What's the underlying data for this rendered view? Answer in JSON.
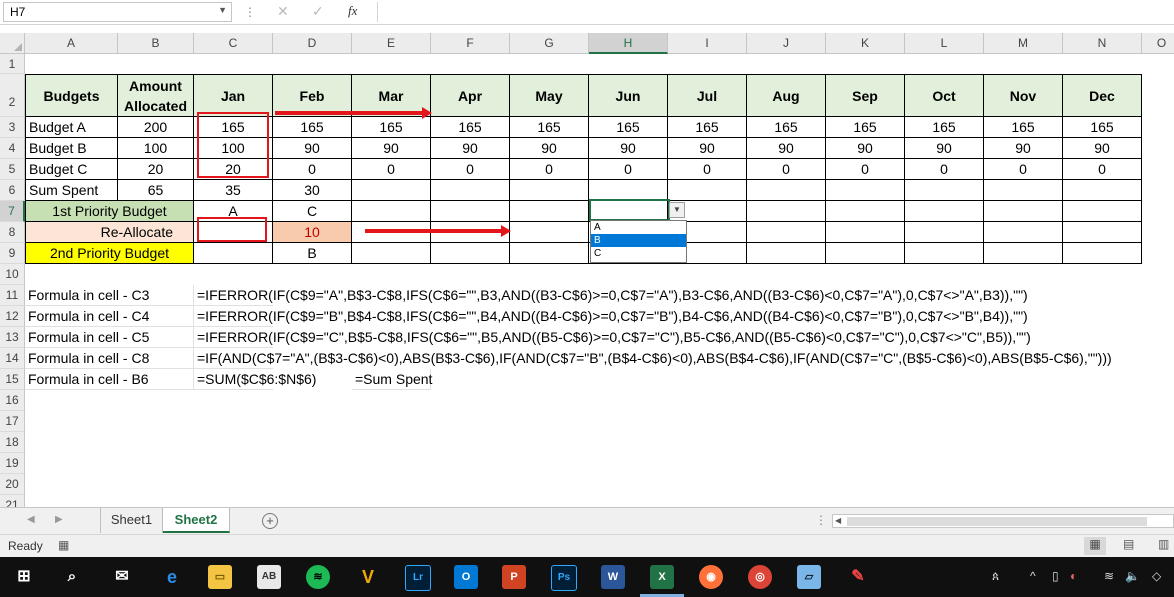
{
  "formula_bar": {
    "name_box": "H7",
    "fx": "fx"
  },
  "columns": [
    {
      "label": "A",
      "w": 93
    },
    {
      "label": "B",
      "w": 76
    },
    {
      "label": "C",
      "w": 79
    },
    {
      "label": "D",
      "w": 79
    },
    {
      "label": "E",
      "w": 79
    },
    {
      "label": "F",
      "w": 79
    },
    {
      "label": "G",
      "w": 79
    },
    {
      "label": "H",
      "w": 79
    },
    {
      "label": "I",
      "w": 79
    },
    {
      "label": "J",
      "w": 79
    },
    {
      "label": "K",
      "w": 79
    },
    {
      "label": "L",
      "w": 79
    },
    {
      "label": "M",
      "w": 79
    },
    {
      "label": "N",
      "w": 79
    },
    {
      "label": "O",
      "w": 40
    }
  ],
  "rows": [
    "1",
    "2",
    "3",
    "4",
    "5",
    "6",
    "7",
    "8",
    "9",
    "10",
    "11",
    "12",
    "13",
    "14",
    "15",
    "16",
    "17",
    "18",
    "19",
    "20",
    "21"
  ],
  "table": {
    "header": [
      "Budgets",
      "Amount Allocated",
      "Jan",
      "Feb",
      "Mar",
      "Apr",
      "May",
      "Jun",
      "Jul",
      "Aug",
      "Sep",
      "Oct",
      "Nov",
      "Dec"
    ],
    "budget_a": [
      "Budget A",
      "200",
      "165",
      "165",
      "165",
      "165",
      "165",
      "165",
      "165",
      "165",
      "165",
      "165",
      "165",
      "165"
    ],
    "budget_b": [
      "Budget B",
      "100",
      "100",
      "90",
      "90",
      "90",
      "90",
      "90",
      "90",
      "90",
      "90",
      "90",
      "90",
      "90"
    ],
    "budget_c": [
      "Budget C",
      "20",
      "20",
      "0",
      "0",
      "0",
      "0",
      "0",
      "0",
      "0",
      "0",
      "0",
      "0",
      "0"
    ],
    "sum_spent": [
      "Sum Spent",
      "65",
      "35",
      "30"
    ],
    "priority1": {
      "label": "1st Priority Budget",
      "jan": "A",
      "feb": "C"
    },
    "reallocate": {
      "label": "Re-Allocate",
      "jan": "",
      "feb": "10"
    },
    "priority2": {
      "label": "2nd Priority Budget",
      "jan": "",
      "feb": "B"
    }
  },
  "formulas": [
    {
      "label": "Formula in cell - C3",
      "text": "=IFERROR(IF(C$9=\"A\",B$3-C$8,IFS(C$6=\"\",B3,AND((B3-C$6)>=0,C$7=\"A\"),B3-C$6,AND((B3-C$6)<0,C$7=\"A\"),0,C$7<>\"A\",B3)),\"\")"
    },
    {
      "label": "Formula in cell - C4",
      "text": "=IFERROR(IF(C$9=\"B\",B$4-C$8,IFS(C$6=\"\",B4,AND((B4-C$6)>=0,C$7=\"B\"),B4-C$6,AND((B4-C$6)<0,C$7=\"B\"),0,C$7<>\"B\",B4)),\"\")"
    },
    {
      "label": "Formula in cell - C5",
      "text": "=IFERROR(IF(C$9=\"C\",B$5-C$8,IFS(C$6=\"\",B5,AND((B5-C$6)>=0,C$7=\"C\"),B5-C$6,AND((B5-C$6)<0,C$7=\"C\"),0,C$7<>\"C\",B5)),\"\")"
    },
    {
      "label": "Formula in cell - C8",
      "text": "=IF(AND(C$7=\"A\",(B$3-C$6)<0),ABS(B$3-C$6),IF(AND(C$7=\"B\",(B$4-C$6)<0),ABS(B$4-C$6),IF(AND(C$7=\"C\",(B$5-C$6)<0),ABS(B$5-C$6),\"\")))"
    },
    {
      "label": "Formula in cell - B6",
      "text": "=SUM($C$6:$N$6)",
      "note": "=Sum Spent"
    }
  ],
  "dropdown": {
    "options": [
      "A",
      "B",
      "C"
    ],
    "selected": "B"
  },
  "sheets": [
    "Sheet1",
    "Sheet2"
  ],
  "active_sheet": "Sheet2",
  "status": {
    "ready": "Ready"
  },
  "colors": {
    "accent": "#217346",
    "header_fill": "#e2efda",
    "green": "#c6e0b4",
    "pink": "#fce4d6",
    "yellow": "#ffff00",
    "red": "#e3171b"
  }
}
